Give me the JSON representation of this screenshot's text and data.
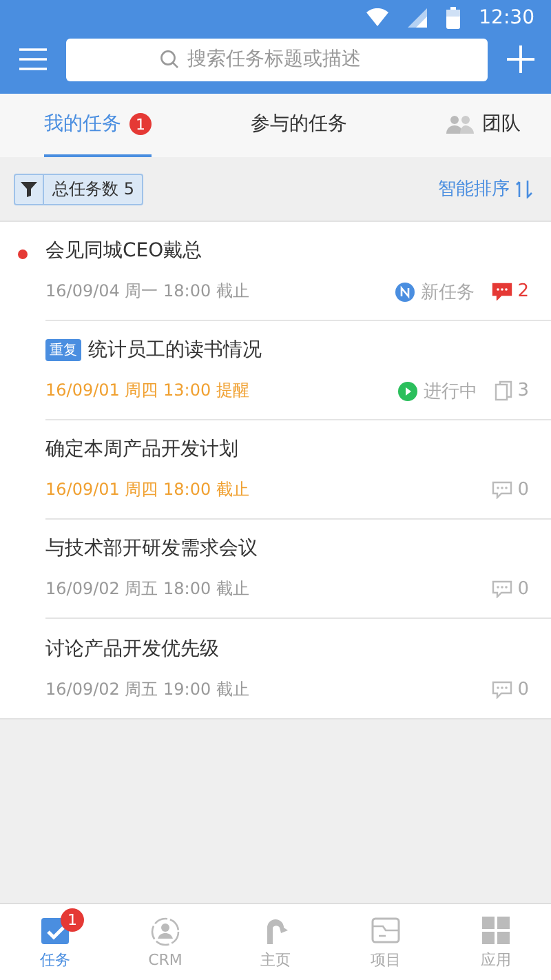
{
  "status_bar": {
    "time": "12:30"
  },
  "search": {
    "placeholder": "搜索任务标题或描述"
  },
  "tabs": [
    {
      "label": "我的任务",
      "badge": "1",
      "selected": true,
      "kind": "plain"
    },
    {
      "label": "参与的任务",
      "selected": false,
      "kind": "plain"
    },
    {
      "label": "团队",
      "selected": false,
      "kind": "team"
    }
  ],
  "filter": {
    "label": "总任务数 5",
    "sort": "智能排序"
  },
  "tasks": [
    {
      "title": "会见同城CEO戴总",
      "unread": true,
      "date": "16/09/04 周一 18:00 截止",
      "due_soon": false,
      "status": {
        "kind": "new",
        "label": "新任务"
      },
      "counter": {
        "kind": "comment",
        "value": "2",
        "unread": true
      }
    },
    {
      "title": "统计员工的读书情况",
      "tag": "重复",
      "unread": false,
      "date": "16/09/01 周四 13:00 提醒",
      "due_soon": true,
      "status": {
        "kind": "progress",
        "label": "进行中"
      },
      "counter": {
        "kind": "attachment",
        "value": "3",
        "unread": false
      }
    },
    {
      "title": "确定本周产品开发计划",
      "unread": false,
      "date": "16/09/01 周四 18:00 截止",
      "due_soon": true,
      "counter": {
        "kind": "comment",
        "value": "0",
        "unread": false
      }
    },
    {
      "title": "与技术部开研发需求会议",
      "unread": false,
      "date": "16/09/02 周五 18:00 截止",
      "due_soon": false,
      "counter": {
        "kind": "comment",
        "value": "0",
        "unread": false
      }
    },
    {
      "title": "讨论产品开发优先级",
      "unread": false,
      "date": "16/09/02 周五 19:00 截止",
      "due_soon": false,
      "counter": {
        "kind": "comment",
        "value": "0",
        "unread": false
      }
    }
  ],
  "nav": [
    {
      "label": "任务",
      "kind": "tasks",
      "badge": "1",
      "selected": true
    },
    {
      "label": "CRM",
      "kind": "crm",
      "selected": false
    },
    {
      "label": "主页",
      "kind": "home",
      "selected": false
    },
    {
      "label": "项目",
      "kind": "project",
      "selected": false
    },
    {
      "label": "应用",
      "kind": "apps",
      "selected": false
    }
  ]
}
